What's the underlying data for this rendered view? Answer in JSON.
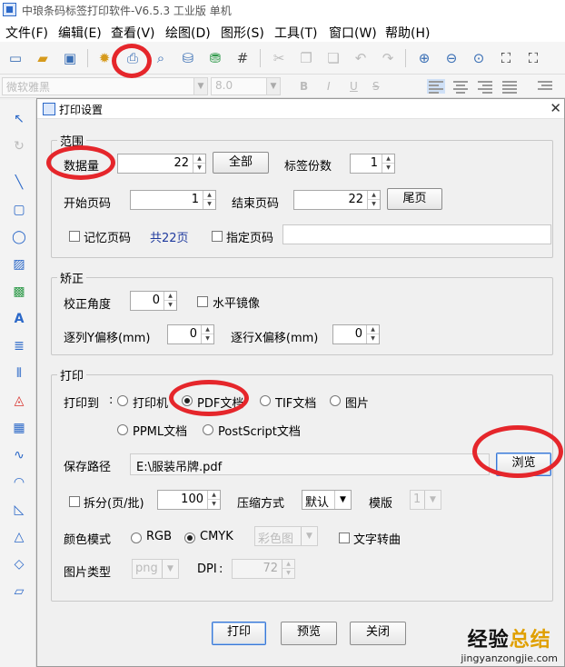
{
  "window": {
    "title": "中琅条码标签打印软件-V6.5.3 工业版 单机"
  },
  "menu": [
    "文件(F)",
    "编辑(E)",
    "查看(V)",
    "绘图(D)",
    "图形(S)",
    "工具(T)",
    "窗口(W)",
    "帮助(H)"
  ],
  "format_bar": {
    "font": "微软雅黑",
    "size": "8.0",
    "bold": "B",
    "italic": "I",
    "underline": "U",
    "strike": "S"
  },
  "dialog": {
    "title": "打印设置",
    "range": {
      "title": "范围",
      "quantity_label": "数据量",
      "quantity": "22",
      "all_button": "全部",
      "copies_label": "标签份数",
      "copies": "1",
      "start_label": "开始页码",
      "start": "1",
      "end_label": "结束页码",
      "end": "22",
      "last_button": "尾页",
      "remember_label": "记忆页码",
      "total_text": "共22页",
      "specify_label": "指定页码"
    },
    "correct": {
      "title": "矫正",
      "angle_label": "校正角度",
      "angle": "0",
      "mirror_label": "水平镜像",
      "y_offset_label": "逐列Y偏移(mm)",
      "y_offset": "0",
      "x_offset_label": "逐行X偏移(mm)",
      "x_offset": "0"
    },
    "print": {
      "title": "打印",
      "print_to_label": "打印到",
      "opt_printer": "打印机",
      "opt_pdf": "PDF文档",
      "opt_tif": "TIF文档",
      "opt_image": "图片",
      "opt_ppml": "PPML文档",
      "opt_postscript": "PostScript文档",
      "save_path_label": "保存路径",
      "save_path": "E:\\服装吊牌.pdf",
      "browse_button": "浏览",
      "split_label": "拆分(页/批)",
      "split": "100",
      "compress_label": "压缩方式",
      "compress": "默认",
      "template_label": "模版",
      "template": "1",
      "color_mode_label": "颜色模式",
      "opt_rgb": "RGB",
      "opt_cmyk": "CMYK",
      "color_combo": "彩色图",
      "text_convert_label": "文字转曲",
      "image_type_label": "图片类型",
      "image_type": "png",
      "dpi_label": "DPI",
      "dpi": "72"
    },
    "buttons": {
      "print": "打印",
      "preview": "预览",
      "close": "关闭"
    }
  },
  "watermark": {
    "line1_a": "经验",
    "line1_b": "总结",
    "url": "jingyanzongjie.com"
  },
  "highlight_color": "#e5262b"
}
